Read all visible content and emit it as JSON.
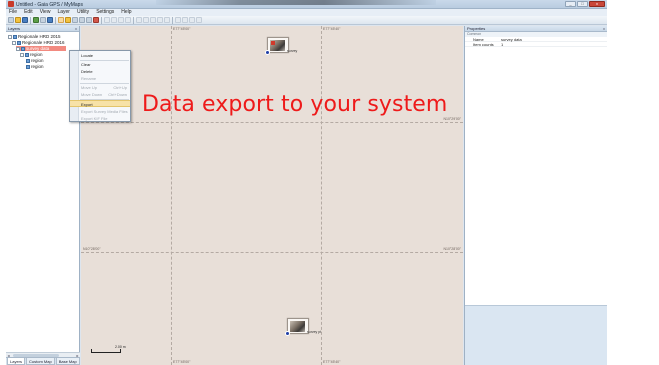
{
  "window": {
    "title": "Untitled - Gaia GPS / MyMaps",
    "buttons": {
      "minimize": "_",
      "maximize": "□",
      "close": "x"
    }
  },
  "menu": [
    "File",
    "Edit",
    "View",
    "Layer",
    "Utility",
    "Settings",
    "Help"
  ],
  "layers_panel": {
    "title": "Layers",
    "pin": "x",
    "tree": [
      {
        "label": "Regionale HRD 2015"
      },
      {
        "label": "Regionale HRD 2016"
      },
      {
        "label": "survey data"
      },
      {
        "label": "region"
      },
      {
        "label": "region"
      },
      {
        "label": "region"
      }
    ],
    "tabs": [
      "Layers",
      "Custom Map",
      "Base Map"
    ]
  },
  "context_menu": {
    "items": [
      {
        "label": "Locate",
        "shortcut": "",
        "disabled": false,
        "active": false
      },
      {
        "label": "Clear",
        "shortcut": "",
        "disabled": false,
        "active": false
      },
      {
        "label": "Delete",
        "shortcut": "",
        "disabled": false,
        "active": false
      },
      {
        "label": "Rename",
        "shortcut": "",
        "disabled": true,
        "active": false
      },
      {
        "label": "Move Up",
        "shortcut": "Ctrl+Up",
        "disabled": true,
        "active": false
      },
      {
        "label": "Move Down",
        "shortcut": "Ctrl+Down",
        "disabled": true,
        "active": false
      },
      {
        "label": "Export",
        "shortcut": "",
        "disabled": false,
        "active": true
      },
      {
        "label": "Export Survey Media Files",
        "shortcut": "",
        "disabled": true,
        "active": false
      },
      {
        "label": "Export KIF File",
        "shortcut": "",
        "disabled": true,
        "active": false
      }
    ]
  },
  "map": {
    "coords_top": [
      "E77°45'00\"",
      "E77°45'40\""
    ],
    "coords_bottom": [
      "E77°45'00\"",
      "E77°45'40\""
    ],
    "coords_left": [
      "N10°28'00\""
    ],
    "coords_right": [
      "N10°29'00\"",
      "N10°28'00\""
    ],
    "markers": [
      {
        "label": "survey"
      },
      {
        "label": "survey pt"
      }
    ],
    "scale_label": "2.00 m"
  },
  "overlay_caption": "Data export to your system",
  "properties_panel": {
    "title": "Properties",
    "pin": "x",
    "section": "Common",
    "rows": [
      {
        "key": "Name",
        "value": "survey data"
      },
      {
        "key": "Item counts",
        "value": "1"
      }
    ]
  }
}
